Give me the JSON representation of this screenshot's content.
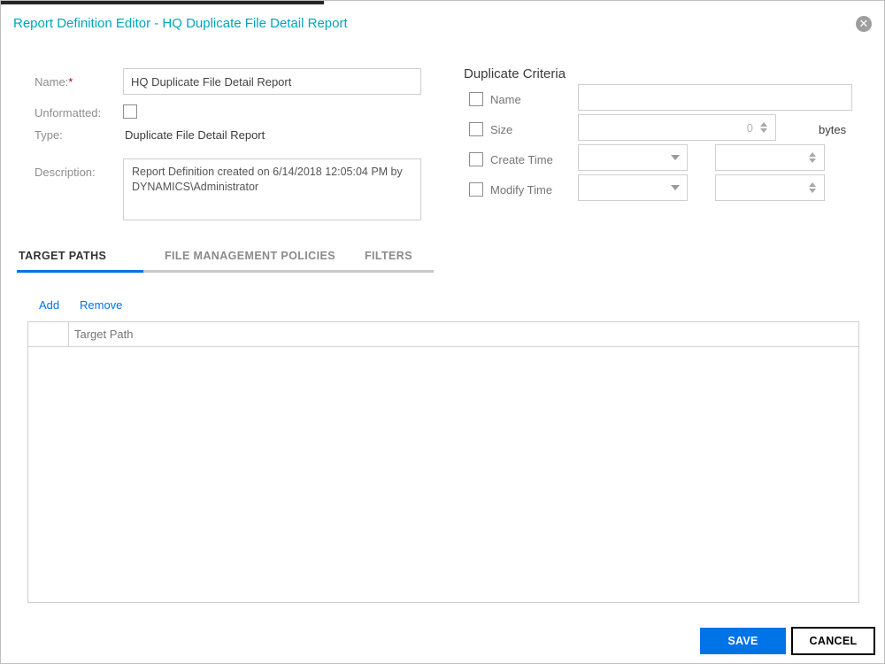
{
  "window": {
    "title": "Report Definition Editor - HQ Duplicate File Detail Report",
    "close_glyph": "✕"
  },
  "form": {
    "name_label": "Name:",
    "required_marker": "*",
    "name_value": "HQ Duplicate File Detail Report",
    "unformatted_label": "Unformatted:",
    "type_label": "Type:",
    "type_value": "Duplicate File Detail Report",
    "description_label": "Description:",
    "description_value": "Report Definition created on 6/14/2018 12:05:04 PM by DYNAMICS\\Administrator"
  },
  "criteria": {
    "heading": "Duplicate Criteria",
    "name_label": "Name",
    "size_label": "Size",
    "size_placeholder": "0",
    "size_unit": "bytes",
    "create_label": "Create Time",
    "modify_label": "Modify Time"
  },
  "tabs": [
    {
      "label": "TARGET PATHS",
      "active": true
    },
    {
      "label": "FILE MANAGEMENT POLICIES",
      "active": false
    },
    {
      "label": "FILTERS",
      "active": false
    }
  ],
  "links": {
    "add": "Add",
    "remove": "Remove"
  },
  "table": {
    "header_target_path": "Target Path"
  },
  "buttons": {
    "save": "SAVE",
    "cancel": "CANCEL"
  },
  "colors": {
    "accent_teal": "#00A5BC",
    "action_blue": "#0073E7"
  }
}
